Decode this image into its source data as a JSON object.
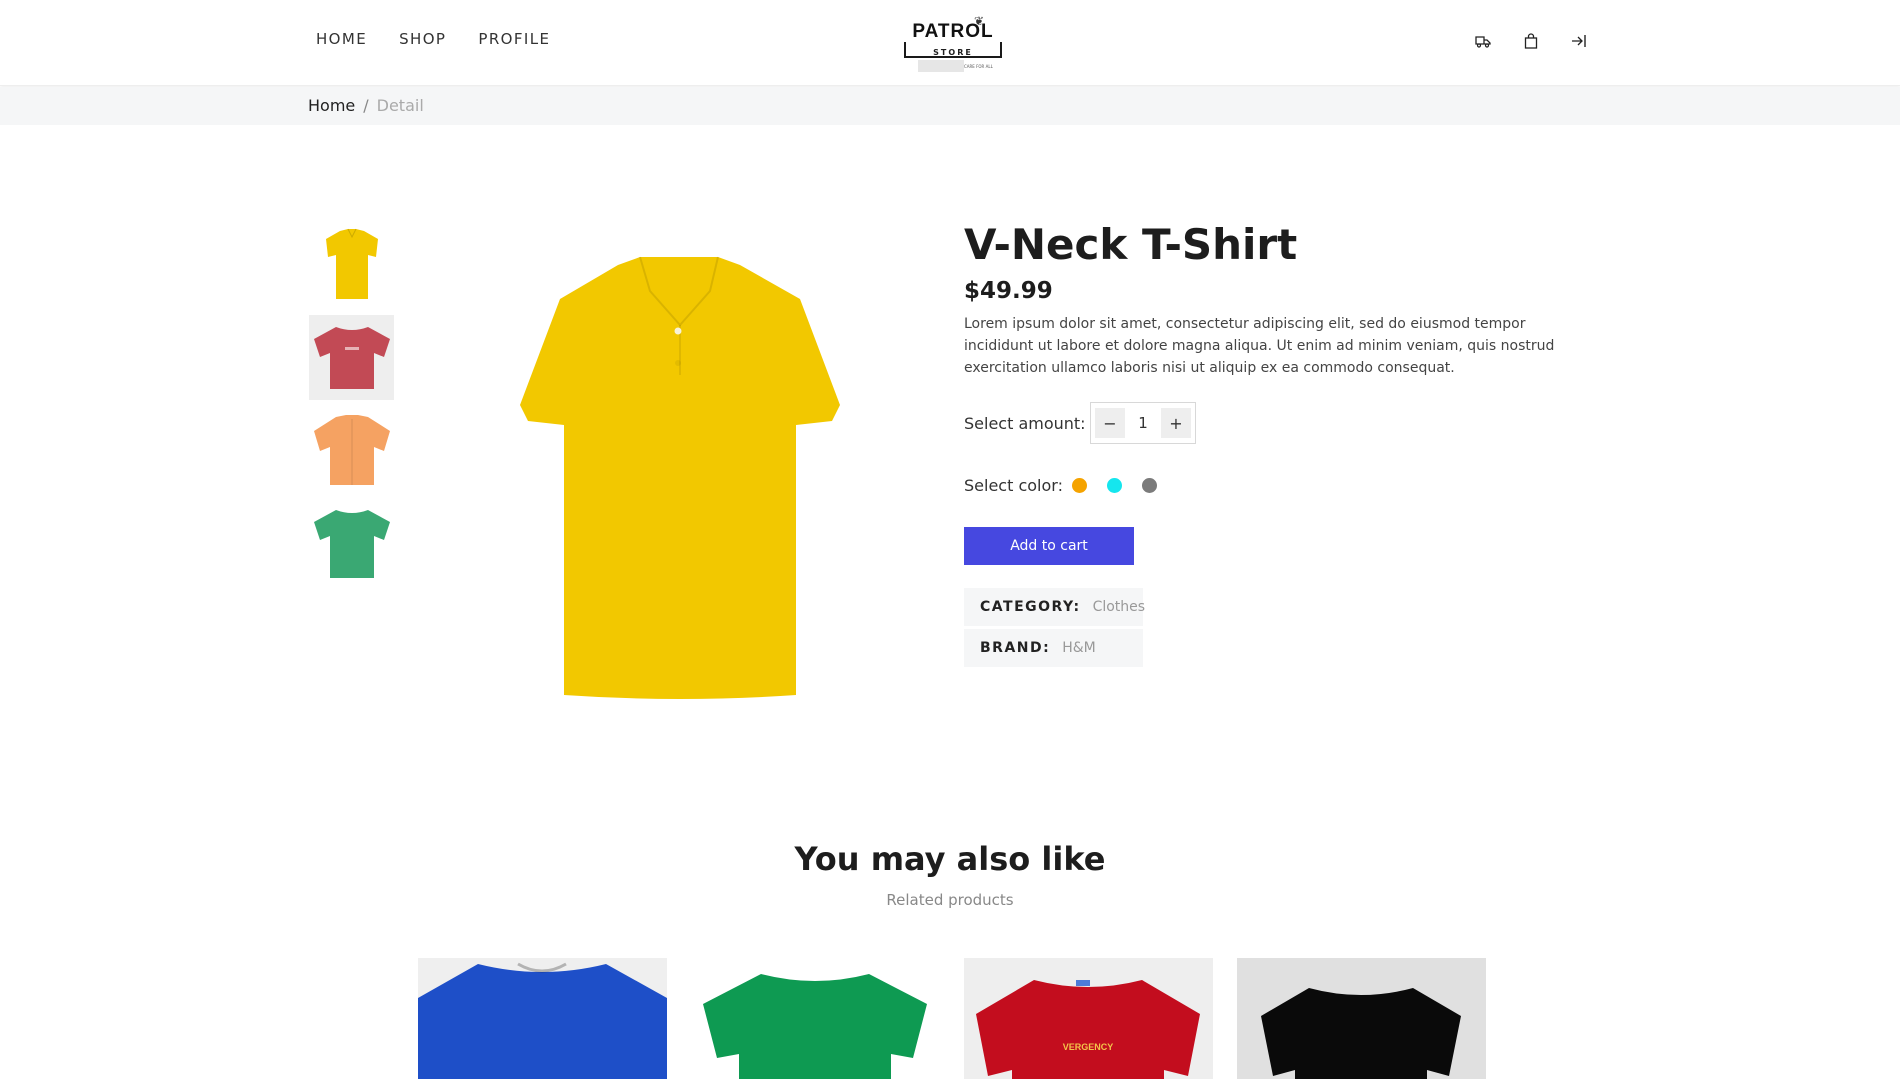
{
  "nav": {
    "items": [
      "HOME",
      "SHOP",
      "PROFILE"
    ]
  },
  "logo": {
    "text": "PATROL",
    "sub": "STORE",
    "tagline": "CARE FOR ALL"
  },
  "header_icons": [
    "truck-icon",
    "bag-icon",
    "login-icon"
  ],
  "breadcrumb": {
    "home": "Home",
    "separator": "/",
    "current": "Detail"
  },
  "thumbnails": [
    {
      "color": "#f2c800",
      "style": "polo"
    },
    {
      "color": "#c24a55",
      "style": "tee"
    },
    {
      "color": "#f5a262",
      "style": "shirt"
    },
    {
      "color": "#3aa873",
      "style": "tee"
    }
  ],
  "product": {
    "title": "V-Neck T-Shirt",
    "price": "$49.99",
    "description": "Lorem ipsum dolor sit amet, consectetur adipiscing elit, sed do eiusmod tempor incididunt ut labore et dolore magna aliqua. Ut enim ad minim veniam, quis nostrud exercitation ullamco laboris nisi ut aliquip ex ea commodo consequat.",
    "main_color": "#f2c800",
    "amount_label": "Select amount:",
    "amount": "1",
    "minus": "−",
    "plus": "+",
    "color_label": "Select color:",
    "colors": [
      "#f5a300",
      "#15e6ee",
      "#7b7b7b"
    ],
    "cart_label": "Add to cart",
    "category_key": "CATEGORY:",
    "category_value": "Clothes",
    "brand_key": "BRAND:",
    "brand_value": "H&M"
  },
  "related": {
    "title": "You may also like",
    "subtitle": "Related products",
    "items": [
      {
        "color": "#1e4fc8",
        "bg": "#efefef"
      },
      {
        "color": "#0e9a52",
        "bg": "#ffffff"
      },
      {
        "color": "#c30d1e",
        "bg": "#eeeeee"
      },
      {
        "color": "#0a0a0a",
        "bg": "#e0e0e0"
      }
    ]
  }
}
